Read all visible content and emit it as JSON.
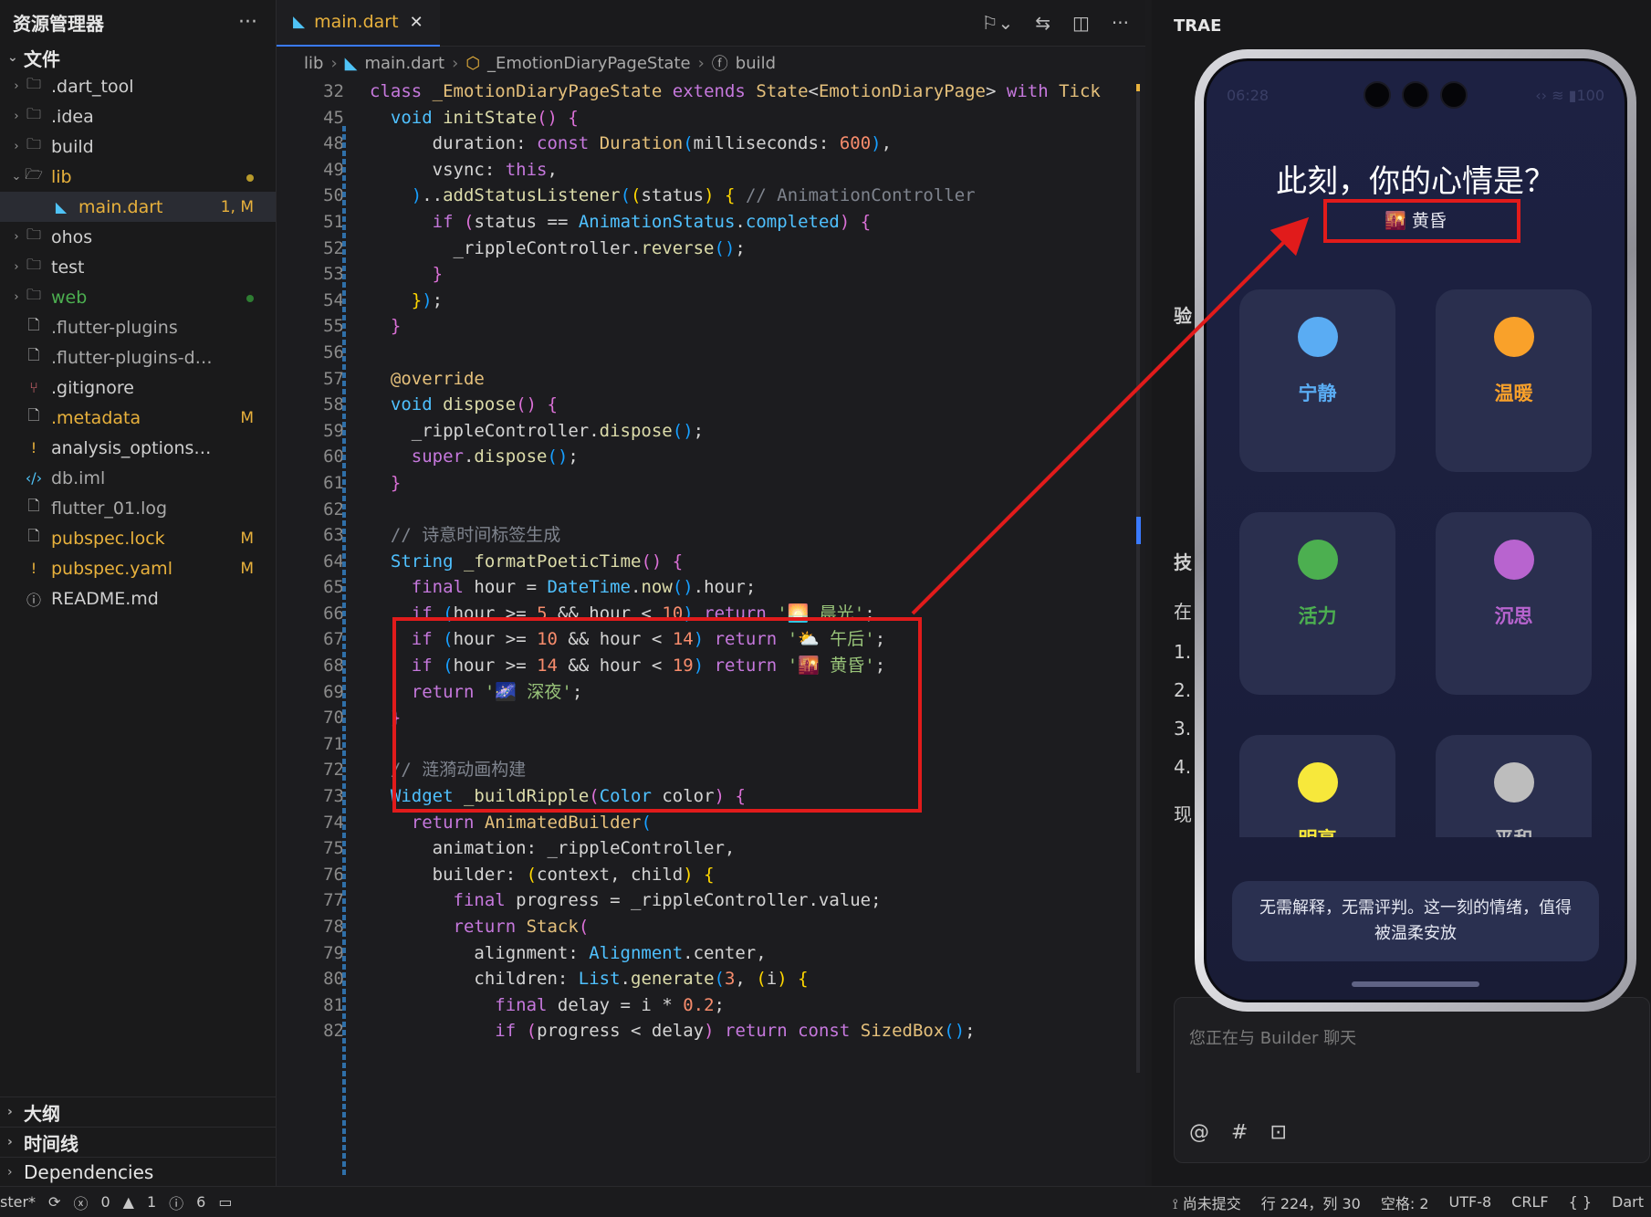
{
  "explorer": {
    "title": "资源管理器",
    "more": "···",
    "section_files": "文件",
    "items": [
      {
        "name": ".dart_tool",
        "type": "folder",
        "badge": ""
      },
      {
        "name": ".idea",
        "type": "folder",
        "badge": ""
      },
      {
        "name": "build",
        "type": "folder",
        "badge": ""
      },
      {
        "name": "lib",
        "type": "folder-open",
        "badge": "",
        "color": "#e8b13c",
        "dot": "#b89a2b"
      },
      {
        "name": "main.dart",
        "type": "dart",
        "badge": "1, M",
        "color": "#e8b13c",
        "active": true
      },
      {
        "name": "ohos",
        "type": "folder",
        "badge": ""
      },
      {
        "name": "test",
        "type": "folder",
        "badge": ""
      },
      {
        "name": "web",
        "type": "folder",
        "badge": "",
        "color": "#4caf50",
        "dot": "#2e7d32"
      },
      {
        "name": ".flutter-plugins",
        "type": "file",
        "badge": "",
        "color": "#a9a9a9"
      },
      {
        "name": ".flutter-plugins-dependen...",
        "type": "file",
        "badge": "",
        "color": "#a9a9a9"
      },
      {
        "name": ".gitignore",
        "type": "git",
        "badge": ""
      },
      {
        "name": ".metadata",
        "type": "file",
        "badge": "M",
        "color": "#e8b13c"
      },
      {
        "name": "analysis_options.yaml",
        "type": "yaml",
        "badge": ""
      },
      {
        "name": "db.iml",
        "type": "xml",
        "badge": "",
        "color": "#a9a9a9"
      },
      {
        "name": "flutter_01.log",
        "type": "file",
        "badge": "",
        "color": "#a9a9a9"
      },
      {
        "name": "pubspec.lock",
        "type": "file",
        "badge": "M",
        "color": "#e8b13c"
      },
      {
        "name": "pubspec.yaml",
        "type": "yaml",
        "badge": "M",
        "color": "#e8b13c"
      },
      {
        "name": "README.md",
        "type": "info",
        "badge": ""
      }
    ],
    "bottom_sections": [
      "大纲",
      "时间线",
      "Dependencies"
    ]
  },
  "editor": {
    "tab_label": "main.dart",
    "breadcrumb": [
      "lib",
      "main.dart",
      "_EmotionDiaryPageState",
      "build"
    ],
    "lines": [
      {
        "n": "32",
        "h": "<span class='kw'>class</span> <span class='fn'>_EmotionDiaryPageState</span> <span class='kw'>extends</span> <span class='fn'>State</span>&lt;<span class='fn'>EmotionDiaryPage</span>&gt; <span class='kw'>with</span> <span class='fn'>Tick</span>"
      },
      {
        "n": "45",
        "h": "  <span class='ty'>void</span> <span class='fc'>initState</span><span class='br2'>()</span> <span class='br2'>{</span>"
      },
      {
        "n": "48",
        "h": "      duration: <span class='kw'>const</span> <span class='fn'>Duration</span><span class='br3'>(</span>milliseconds: <span class='num'>600</span><span class='br3'>)</span>,"
      },
      {
        "n": "49",
        "h": "      vsync: <span class='kw'>this</span>,"
      },
      {
        "n": "50",
        "h": "    <span class='br3'>)</span>..<span class='fc'>addStatusListener</span><span class='br3'>(</span><span class='br1'>(</span>status<span class='br1'>)</span> <span class='br1'>{</span> <span class='cm'>// AnimationController</span>"
      },
      {
        "n": "51",
        "h": "      <span class='kw'>if</span> <span class='br2'>(</span>status == <span class='ty'>AnimationStatus</span>.<span class='ty'>completed</span><span class='br2'>)</span> <span class='br2'>{</span>"
      },
      {
        "n": "52",
        "h": "        _rippleController.<span class='fc'>reverse</span><span class='br3'>()</span>;"
      },
      {
        "n": "53",
        "h": "      <span class='br2'>}</span>"
      },
      {
        "n": "54",
        "h": "    <span class='br1'>}</span><span class='br3'>)</span>;"
      },
      {
        "n": "55",
        "h": "  <span class='br2'>}</span>"
      },
      {
        "n": "56",
        "h": ""
      },
      {
        "n": "57",
        "h": "  <span class='fn'>@override</span>"
      },
      {
        "n": "58",
        "h": "  <span class='ty'>void</span> <span class='fc'>dispose</span><span class='br2'>()</span> <span class='br2'>{</span>"
      },
      {
        "n": "59",
        "h": "    _rippleController.<span class='fc'>dispose</span><span class='br3'>()</span>;"
      },
      {
        "n": "60",
        "h": "    <span class='kw'>super</span>.<span class='fc'>dispose</span><span class='br3'>()</span>;"
      },
      {
        "n": "61",
        "h": "  <span class='br2'>}</span>"
      },
      {
        "n": "62",
        "h": ""
      },
      {
        "n": "63",
        "h": "  <span class='cm'>// 诗意时间标签生成</span>"
      },
      {
        "n": "64",
        "h": "  <span class='ty'>String</span> <span class='fc'>_formatPoeticTime</span><span class='br2'>()</span> <span class='br2'>{</span>"
      },
      {
        "n": "65",
        "h": "    <span class='kw'>final</span> hour = <span class='ty'>DateTime</span>.<span class='fc'>now</span><span class='br3'>()</span>.hour;"
      },
      {
        "n": "66",
        "h": "    <span class='kw'>if</span> <span class='br3'>(</span>hour &gt;= <span class='num'>5</span> &amp;&amp; hour &lt; <span class='num'>10</span><span class='br3'>)</span> <span class='kw'>return</span> <span class='str'>'🌅 晨光'</span>;"
      },
      {
        "n": "67",
        "h": "    <span class='kw'>if</span> <span class='br3'>(</span>hour &gt;= <span class='num'>10</span> &amp;&amp; hour &lt; <span class='num'>14</span><span class='br3'>)</span> <span class='kw'>return</span> <span class='str'>'⛅ 午后'</span>;"
      },
      {
        "n": "68",
        "h": "    <span class='kw'>if</span> <span class='br3'>(</span>hour &gt;= <span class='num'>14</span> &amp;&amp; hour &lt; <span class='num'>19</span><span class='br3'>)</span> <span class='kw'>return</span> <span class='str'>'🌇 黄昏'</span>;"
      },
      {
        "n": "69",
        "h": "    <span class='kw'>return</span> <span class='str'>'🌌 深夜'</span>;"
      },
      {
        "n": "70",
        "h": "  <span class='br2'>}</span>"
      },
      {
        "n": "71",
        "h": ""
      },
      {
        "n": "72",
        "h": "  <span class='cm'>// 涟漪动画构建</span>"
      },
      {
        "n": "73",
        "h": "  <span class='ty'>Widget</span> <span class='fc'>_buildRipple</span><span class='br2'>(</span><span class='ty'>Color</span> color<span class='br2'>)</span> <span class='br2'>{</span>"
      },
      {
        "n": "74",
        "h": "    <span class='kw'>return</span> <span class='fn'>AnimatedBuilder</span><span class='br3'>(</span>"
      },
      {
        "n": "75",
        "h": "      animation: _rippleController,"
      },
      {
        "n": "76",
        "h": "      builder: <span class='br1'>(</span>context, child<span class='br1'>)</span> <span class='br1'>{</span>"
      },
      {
        "n": "77",
        "h": "        <span class='kw'>final</span> progress = _rippleController.value;"
      },
      {
        "n": "78",
        "h": "        <span class='kw'>return</span> <span class='fn'>Stack</span><span class='br2'>(</span>"
      },
      {
        "n": "79",
        "h": "          alignment: <span class='ty'>Alignment</span>.center,"
      },
      {
        "n": "80",
        "h": "          children: <span class='ty'>List</span>.<span class='fc'>generate</span><span class='br3'>(</span><span class='num'>3</span>, <span class='br1'>(</span>i<span class='br1'>)</span> <span class='br1'>{</span>"
      },
      {
        "n": "81",
        "h": "            <span class='kw'>final</span> delay = i * <span class='num'>0.2</span>;"
      },
      {
        "n": "82",
        "h": "            <span class='kw'>if</span> <span class='br2'>(</span>progress &lt; delay<span class='br2'>)</span> <span class='kw'>return</span> <span class='kw'>const</span> <span class='fn'>SizedBox</span><span class='br3'>()</span>;"
      }
    ]
  },
  "right_panel": {
    "title": "TRAE",
    "chat_placeholder": "您正在与 Builder 聊天",
    "side_fragments": [
      "验",
      "技",
      "在",
      "1.",
      "2.",
      "3.",
      "4.",
      "现"
    ]
  },
  "phone": {
    "status_time": "06:28",
    "battery": "100",
    "title": "此刻，你的心情是？",
    "time_label": "🌇 黄昏",
    "moods": [
      {
        "label": "宁静",
        "color": "#5aacf3"
      },
      {
        "label": "温暖",
        "color": "#f9a12a"
      },
      {
        "label": "活力",
        "color": "#4caf50"
      },
      {
        "label": "沉思",
        "color": "#b864cf"
      },
      {
        "label": "明亮",
        "color": "#f7e83b"
      },
      {
        "label": "平和",
        "color": "#bdbdbd"
      }
    ],
    "quote": "无需解释，无需评判。这一刻的情绪，值得被温柔安放"
  },
  "statusbar": {
    "branch": "ster*",
    "errors": "0",
    "warnings": "1",
    "infos": "6",
    "git": "尚未提交",
    "position": "行 224，列 30",
    "spaces": "空格: 2",
    "encoding": "UTF-8",
    "eol": "CRLF",
    "braces": "{ }",
    "language": "Dart"
  },
  "colors": {
    "accent_red": "#e11b1b",
    "modified": "#e8b13c"
  }
}
